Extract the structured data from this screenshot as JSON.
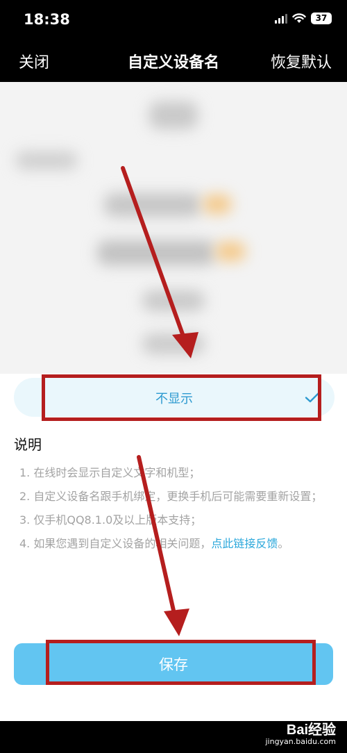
{
  "status_bar": {
    "time": "18:38",
    "battery": "37"
  },
  "nav": {
    "close_label": "关闭",
    "title": "自定义设备名",
    "reset_label": "恢复默认"
  },
  "option": {
    "label": "不显示",
    "selected": true
  },
  "description": {
    "title": "说明",
    "items": [
      "1. 在线时会显示自定义文字和机型；",
      "2. 自定义设备名跟手机绑定，更换手机后可能需要重新设置；",
      "3. 仅手机QQ8.1.0及以上版本支持；"
    ],
    "item4_text": "4. 如果您遇到自定义设备的相关问题，",
    "item4_link": "点此链接反馈",
    "item4_end": "。"
  },
  "save_label": "保存",
  "watermark": {
    "main": "Bai经验",
    "sub": "jingyan.baidu.com"
  },
  "colors": {
    "accent": "#62c5f1",
    "link": "#2aa7db",
    "annotation": "#b51e1e"
  }
}
